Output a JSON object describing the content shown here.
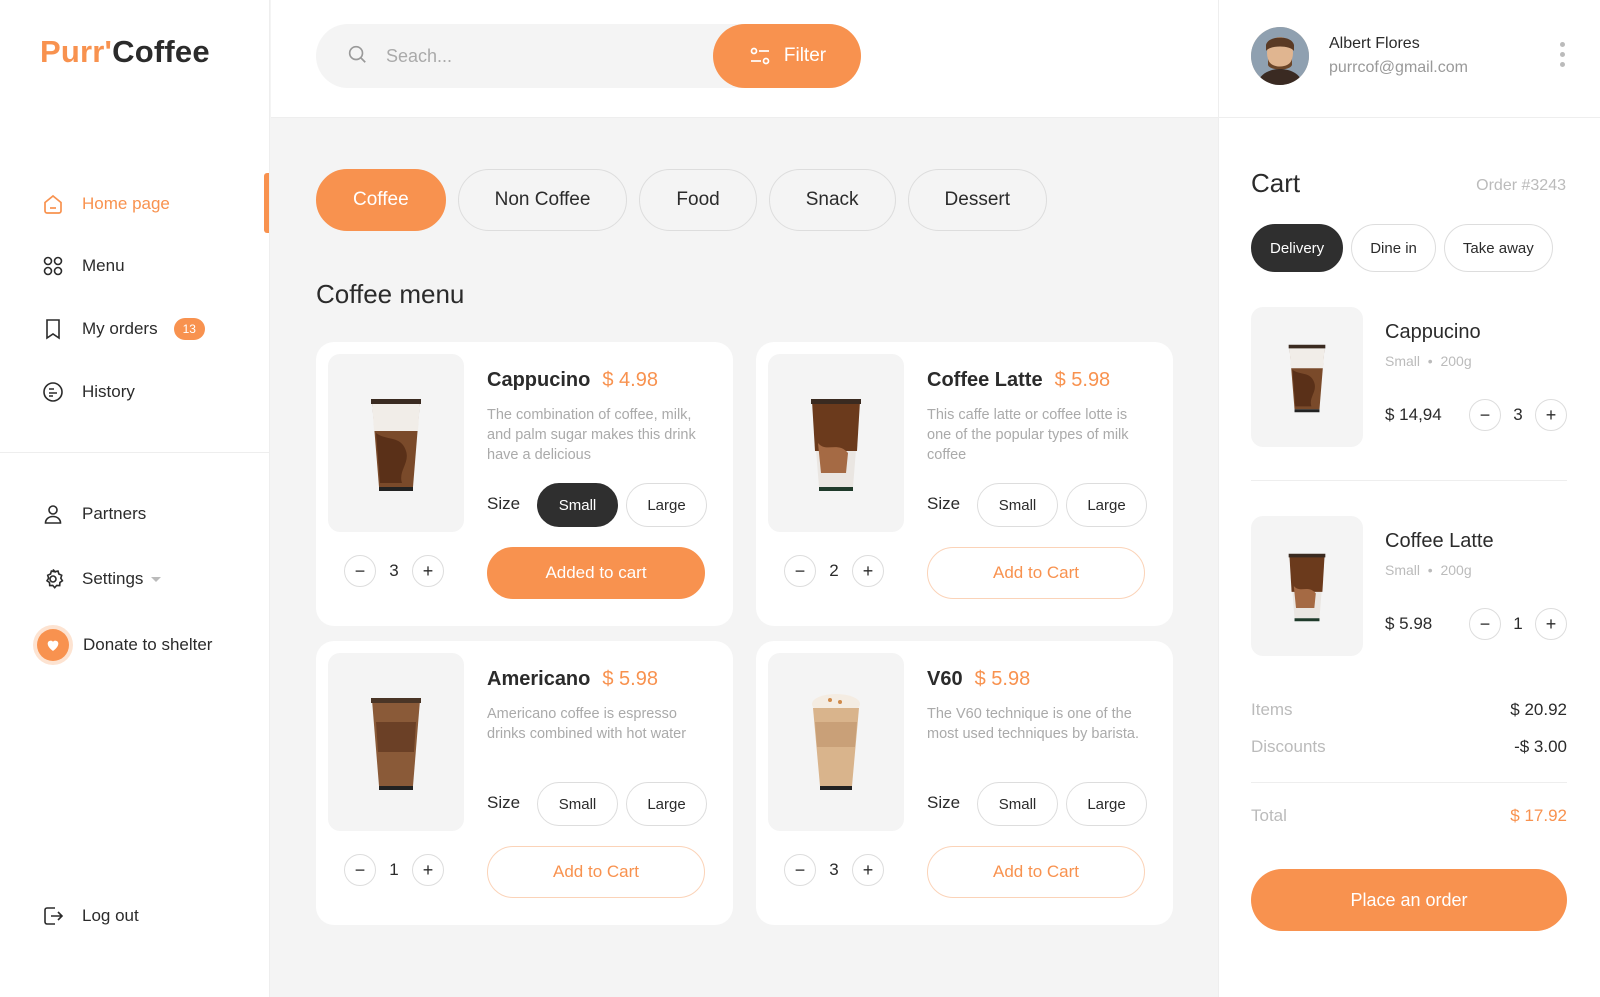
{
  "brand": {
    "part1": "Purr'",
    "part2": "Coffee"
  },
  "sidebar": {
    "items": [
      {
        "label": "Home page",
        "icon": "home-icon"
      },
      {
        "label": "Menu",
        "icon": "grid-icon"
      },
      {
        "label": "My orders",
        "icon": "receipt-icon",
        "badge": "13"
      },
      {
        "label": "History",
        "icon": "history-icon"
      }
    ],
    "secondary": [
      {
        "label": "Partners",
        "icon": "user-icon"
      },
      {
        "label": "Settings",
        "icon": "gear-icon"
      },
      {
        "label": "Donate to shelter",
        "icon": "heart-icon"
      }
    ],
    "logout": "Log out"
  },
  "search": {
    "placeholder": "Seach...",
    "filter_label": "Filter"
  },
  "categories": [
    "Coffee",
    "Non Coffee",
    "Food",
    "Snack",
    "Dessert"
  ],
  "section_title": "Coffee menu",
  "products": [
    {
      "name": "Cappucino",
      "price": "$ 4.98",
      "desc": "The combination of coffee, milk, and palm sugar makes this drink have a delicious",
      "size_label": "Size",
      "small": "Small",
      "large": "Large",
      "qty": "3",
      "action": "Added to cart"
    },
    {
      "name": "Coffee Latte",
      "price": "$ 5.98",
      "desc": "This caffe latte or coffee lotte is one of the popular types of milk coffee",
      "size_label": "Size",
      "small": "Small",
      "large": "Large",
      "qty": "2",
      "action": "Add to Cart"
    },
    {
      "name": "Americano",
      "price": "$ 5.98",
      "desc": "Americano coffee is espresso drinks combined with hot water",
      "size_label": "Size",
      "small": "Small",
      "large": "Large",
      "qty": "1",
      "action": "Add to Cart"
    },
    {
      "name": "V60",
      "price": "$ 5.98",
      "desc": "The V60 technique is one of the most used techniques by barista.",
      "size_label": "Size",
      "small": "Small",
      "large": "Large",
      "qty": "3",
      "action": "Add to Cart"
    }
  ],
  "user": {
    "name": "Albert Flores",
    "email": "purrcof@gmail.com"
  },
  "cart": {
    "title": "Cart",
    "order_no": "Order #3243",
    "modes": [
      "Delivery",
      "Dine in",
      "Take away"
    ],
    "items": [
      {
        "name": "Cappucino",
        "size": "Small",
        "weight": "200g",
        "price": "$ 14,94",
        "qty": "3"
      },
      {
        "name": "Coffee Latte",
        "size": "Small",
        "weight": "200g",
        "price": "$ 5.98",
        "qty": "1"
      }
    ],
    "summary": {
      "items_label": "Items",
      "items_value": "$ 20.92",
      "discounts_label": "Discounts",
      "discounts_value": "-$ 3.00",
      "total_label": "Total",
      "total_value": "$ 17.92"
    },
    "place_order": "Place an order"
  },
  "colors": {
    "accent": "#f8924f",
    "dark": "#2f2f2f"
  }
}
